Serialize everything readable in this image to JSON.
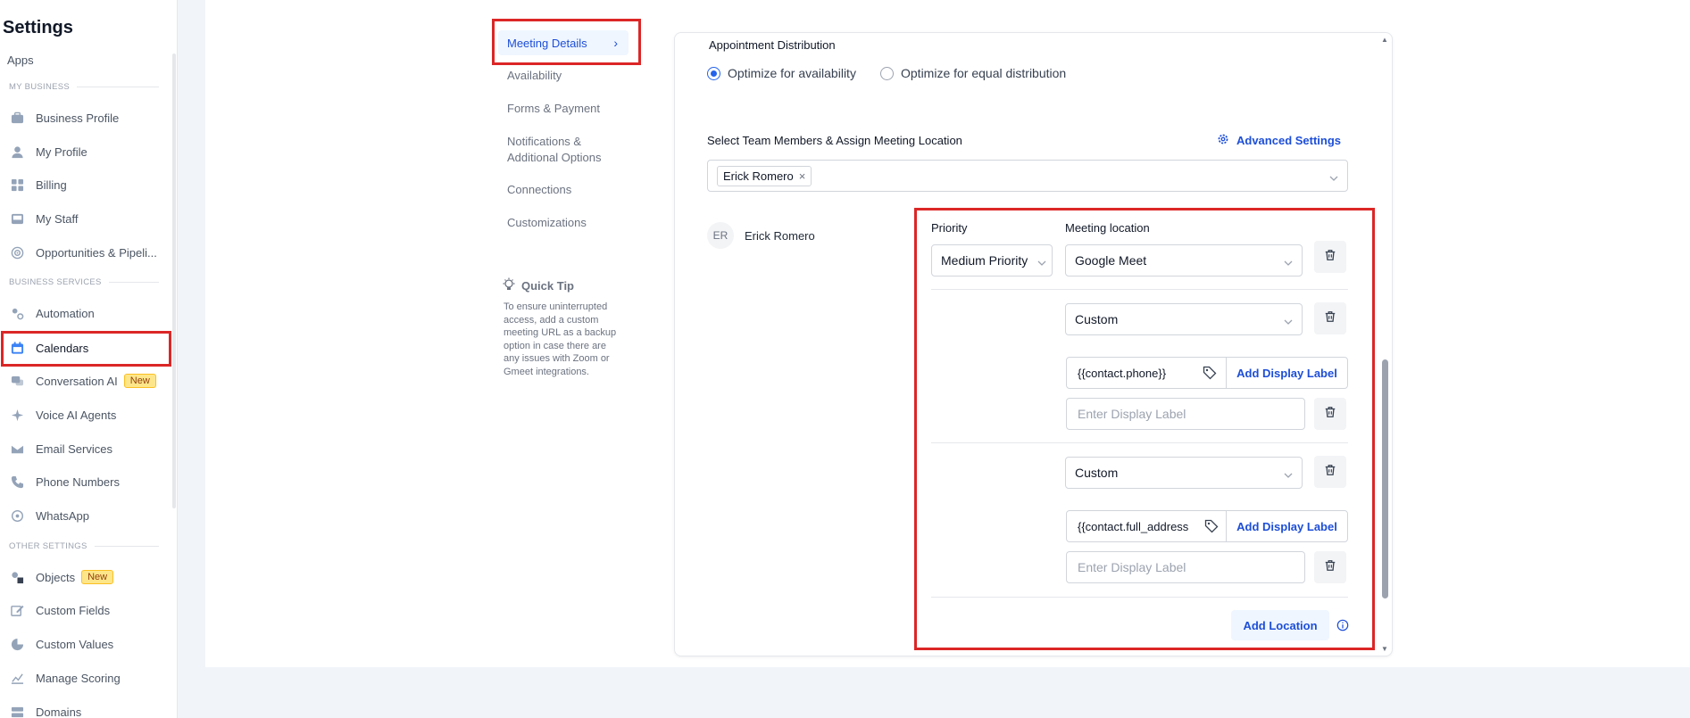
{
  "sidebar": {
    "title": "Settings",
    "apps": "Apps",
    "sections": {
      "my_business": "MY BUSINESS",
      "business_services": "BUSINESS SERVICES",
      "other_settings": "OTHER SETTINGS"
    },
    "items": [
      {
        "label": "Business Profile",
        "icon": "briefcase-icon"
      },
      {
        "label": "My Profile",
        "icon": "user-icon"
      },
      {
        "label": "Billing",
        "icon": "grid-icon"
      },
      {
        "label": "My Staff",
        "icon": "inbox-icon"
      },
      {
        "label": "Opportunities & Pipeli...",
        "icon": "target-icon"
      },
      {
        "label": "Automation",
        "icon": "gears-icon"
      },
      {
        "label": "Calendars",
        "icon": "calendar-icon"
      },
      {
        "label": "Conversation AI",
        "icon": "chat-icon",
        "badge": "New"
      },
      {
        "label": "Voice AI Agents",
        "icon": "voice-icon"
      },
      {
        "label": "Email Services",
        "icon": "mail-icon"
      },
      {
        "label": "Phone Numbers",
        "icon": "phone-icon"
      },
      {
        "label": "WhatsApp",
        "icon": "whatsapp-icon"
      },
      {
        "label": "Objects",
        "icon": "shapes-icon",
        "badge": "New"
      },
      {
        "label": "Custom Fields",
        "icon": "edit-icon"
      },
      {
        "label": "Custom Values",
        "icon": "pie-icon"
      },
      {
        "label": "Manage Scoring",
        "icon": "chart-icon"
      },
      {
        "label": "Domains",
        "icon": "server-icon"
      }
    ]
  },
  "subnav": {
    "active": "Meeting Details",
    "items": [
      "Availability",
      "Forms & Payment",
      "Notifications & Additional Options",
      "Connections",
      "Customizations"
    ],
    "tip_title": "Quick Tip",
    "tip_text": "To ensure uninterrupted access, add a custom meeting URL as a backup option in case there are any issues with Zoom or Gmeet integrations."
  },
  "form": {
    "distribution_label": "Appointment Distribution",
    "opt_availability": "Optimize for availability",
    "opt_equal": "Optimize for equal distribution",
    "team_label": "Select Team Members & Assign Meeting Location",
    "advanced_settings": "Advanced Settings",
    "chip": "Erick Romero",
    "member": {
      "initials": "ER",
      "name": "Erick Romero"
    },
    "priority_header": "Priority",
    "location_header": "Meeting location",
    "priority_value": "Medium Priority",
    "locations": [
      {
        "type": "Google Meet"
      },
      {
        "type": "Custom",
        "value": "{{contact.phone}}",
        "add_label": "Add Display Label",
        "display_placeholder": "Enter Display Label"
      },
      {
        "type": "Custom",
        "value": "{{contact.full_address",
        "add_label": "Add Display Label",
        "display_placeholder": "Enter Display Label"
      }
    ],
    "add_location": "Add Location"
  },
  "colors": {
    "accent": "#1d4ed8",
    "highlight": "#dc2626"
  }
}
